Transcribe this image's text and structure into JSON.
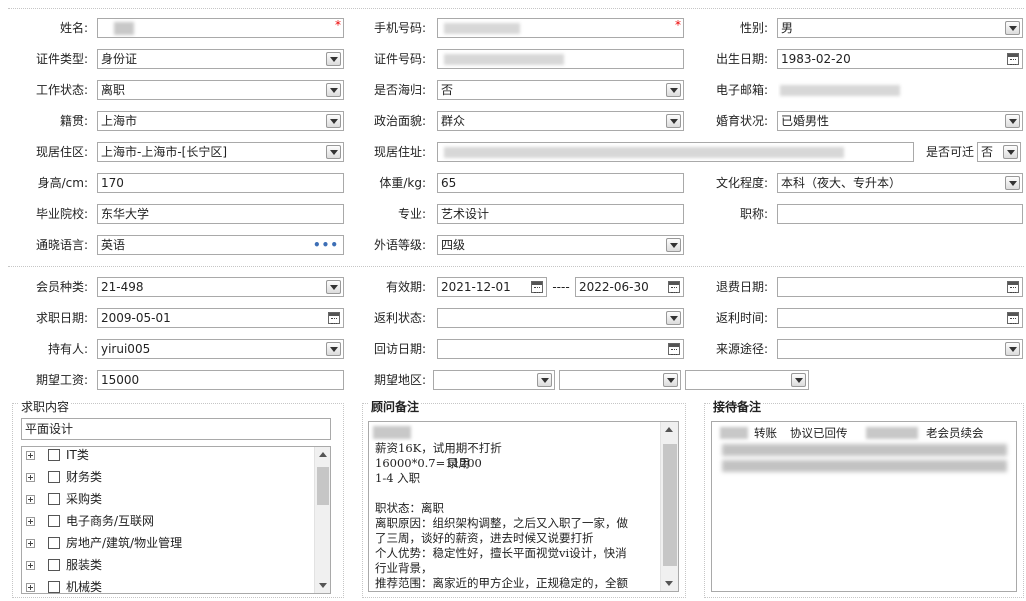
{
  "personal": {
    "name_label": "姓名:",
    "mobile_label": "手机号码:",
    "gender_label": "性别:",
    "gender_value": "男",
    "id_type_label": "证件类型:",
    "id_type_value": "身份证",
    "id_number_label": "证件号码:",
    "birth_label": "出生日期:",
    "birth_value": "1983-02-20",
    "work_status_label": "工作状态:",
    "work_status_value": "离职",
    "returnee_label": "是否海归:",
    "returnee_value": "否",
    "email_label": "电子邮箱:",
    "native_label": "籍贯:",
    "native_value": "上海市",
    "political_label": "政治面貌:",
    "political_value": "群众",
    "marital_label": "婚育状况:",
    "marital_value": "已婚男性",
    "residence_area_label": "现居住区:",
    "residence_area_value": "上海市-上海市-[长宁区]",
    "address_label": "现居住址:",
    "relocate_label": "是否可迁",
    "relocate_value": "否",
    "height_label": "身高/cm:",
    "height_value": "170",
    "weight_label": "体重/kg:",
    "weight_value": "65",
    "education_label": "文化程度:",
    "education_value": "本科（夜大、专升本）",
    "school_label": "毕业院校:",
    "school_value": "东华大学",
    "major_label": "专业:",
    "major_value": "艺术设计",
    "title_label": "职称:",
    "title_value": "",
    "language_label": "通晓语言:",
    "language_value": "英语",
    "language_more": "•••",
    "lang_level_label": "外语等级:",
    "lang_level_value": "四级",
    "required_mark": "*"
  },
  "membership": {
    "member_type_label": "会员种类:",
    "member_type_value": "21-498",
    "valid_label": "有效期:",
    "valid_from": "2021-12-01",
    "valid_sep": "----",
    "valid_to": "2022-06-30",
    "refund_date_label": "退费日期:",
    "refund_date_value": "",
    "job_date_label": "求职日期:",
    "job_date_value": "2009-05-01",
    "rebate_status_label": "返利状态:",
    "rebate_status_value": "",
    "rebate_time_label": "返利时间:",
    "rebate_time_value": "",
    "holder_label": "持有人:",
    "holder_value": "yirui005",
    "visit_date_label": "回访日期:",
    "visit_date_value": "",
    "source_label": "来源途径:",
    "source_value": "",
    "salary_label": "期望工资:",
    "salary_value": "15000",
    "region_label": "期望地区:"
  },
  "job_content": {
    "title": "求职内容",
    "selected": "平面设计",
    "items": [
      {
        "label": "IT类"
      },
      {
        "label": "财务类"
      },
      {
        "label": "采购类"
      },
      {
        "label": "电子商务/互联网"
      },
      {
        "label": "房地产/建筑/物业管理"
      },
      {
        "label": "服装类"
      },
      {
        "label": "机械类"
      }
    ]
  },
  "consultant_notes": {
    "title": "顾问备注",
    "line1": "录用",
    "text": "薪资16K，试用期不打折\n16000*0.7=11200\n1-4 入职\n\n职状态：离职\n离职原因：组织架构调整，之后又入职了一家，做\n了三周，谈好的薪资，进去时候又说要打折\n个人优势：稳定性好，擅长平面视觉vi设计，快消\n行业背景，\n推荐范围：离家近的甲方企业，正规稳定的，全额"
  },
  "reception_notes": {
    "title": "接待备注",
    "line1_a": "转账",
    "line1_b": "协议已回传",
    "line1_c": "老会员续会"
  }
}
